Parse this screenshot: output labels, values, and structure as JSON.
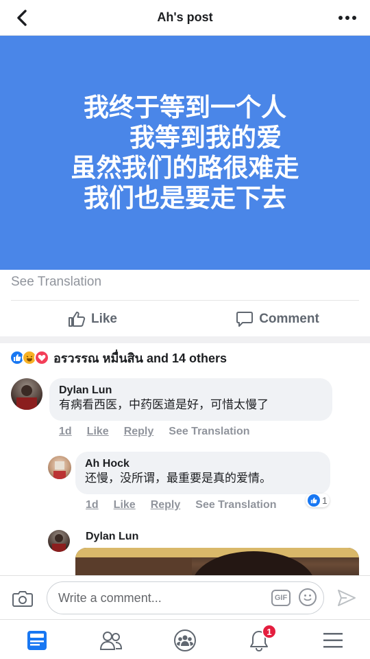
{
  "header": {
    "title": "Ah's post"
  },
  "post": {
    "lines": [
      "我终于等到一个人",
      "我等到我的爱",
      "虽然我们的路很难走",
      "我们也是要走下去"
    ],
    "background": "#4a86e8",
    "see_translation": "See Translation"
  },
  "actions": {
    "like": "Like",
    "comment": "Comment"
  },
  "reactions": {
    "text": "อรวรรณ หมื่นสิน and 14 others",
    "icons": [
      "like-icon",
      "haha-icon",
      "love-icon"
    ]
  },
  "comments": [
    {
      "name": "Dylan Lun",
      "text": "有病看西医，中药医道是好，可惜太慢了",
      "time": "1d",
      "like": "Like",
      "reply": "Reply",
      "translate": "See Translation"
    },
    {
      "name": "Ah Hock",
      "text": "还慢，没所谓，最重要是真的爱情。",
      "time": "1d",
      "like": "Like",
      "reply": "Reply",
      "translate": "See Translation",
      "like_count": "1"
    },
    {
      "name": "Dylan Lun"
    }
  ],
  "composer": {
    "placeholder": "Write a comment...",
    "gif": "GIF"
  },
  "tabbar": {
    "items": [
      "news-feed-icon",
      "friends-icon",
      "groups-icon",
      "notifications-icon",
      "menu-icon"
    ],
    "notification_badge": "1"
  },
  "colors": {
    "accent": "#1877f2",
    "badge": "#e41e3f"
  }
}
